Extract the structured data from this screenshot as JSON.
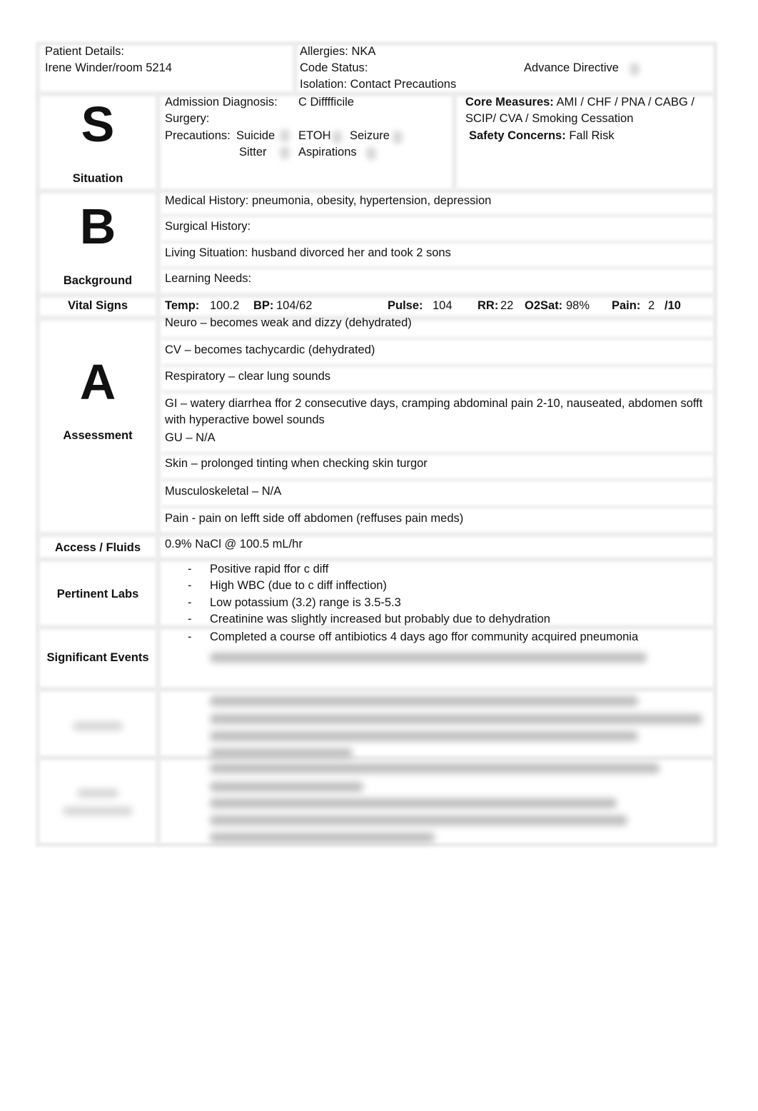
{
  "header": {
    "patient_details_label": "Patient Details:",
    "patient_name_room": "Irene Winder/room 5214",
    "allergies": "Allergies: NKA",
    "code_status": "Code Status:",
    "isolation": "Isolation: Contact Precautions",
    "advance_directive": "Advance Directive"
  },
  "situation": {
    "letter": "S",
    "label": "Situation",
    "admission_diagnosis_label": "Admission Diagnosis:",
    "admission_diagnosis_value": "C Difffficile",
    "surgery_label": "Surgery:",
    "precautions_label": "Precautions:",
    "precaution_options": [
      "Suicide",
      "ETOH",
      "Seizure",
      "Sitter",
      "Aspirations"
    ],
    "core_measures_label": "Core Measures:",
    "core_measures_value_line1": "AMI / CHF / PNA / CABG /",
    "core_measures_value_line2": "SCIP/ CVA / Smoking Cessation",
    "safety_concerns_label": "Safety Concerns:",
    "safety_concerns_value": "Fall Risk"
  },
  "background": {
    "letter": "B",
    "label": "Background",
    "medical_history": "Medical History: pneumonia, obesity, hypertension, depression",
    "surgical_history": "Surgical History:",
    "living_situation": "Living Situation: husband divorced her and took 2 sons",
    "learning_needs": "Learning Needs:"
  },
  "vital_signs": {
    "label": "Vital Signs",
    "temp_label": "Temp:",
    "temp": "100.2",
    "bp_label": "BP:",
    "bp": "104/62",
    "pulse_label": "Pulse:",
    "pulse": "104",
    "rr_label": "RR:",
    "rr": "22",
    "o2sat_label": "O2Sat:",
    "o2sat": "98%",
    "pain_label": "Pain:",
    "pain": "2",
    "pain_scale": "/10"
  },
  "assessment": {
    "letter": "A",
    "label": "Assessment",
    "items": [
      "Neuro – becomes weak and dizzy (dehydrated)",
      "CV – becomes tachycardic (dehydrated)",
      "Respiratory – clear lung sounds",
      "GI – watery diarrhea ffor 2 consecutive days, cramping abdominal pain 2-10, nauseated, abdomen sofft with hyperactive bowel sounds",
      "GU – N/A",
      "Skin – prolonged tinting when checking skin turgor",
      "Musculoskeletal – N/A",
      "Pain - pain on lefft side off abdomen (reffuses pain meds)"
    ]
  },
  "access_fluids": {
    "label": "Access / Fluids",
    "value": "0.9% NaCl @ 100.5 mL/hr"
  },
  "pertinent_labs": {
    "label": "Pertinent Labs",
    "bullet": "-",
    "items": [
      "Positive rapid ffor c diff",
      "High WBC (due to c diff inffection)",
      "Low potassium (3.2) range is 3.5-5.3",
      "Creatinine was slightly increased but probably due to dehydration"
    ]
  },
  "significant_events": {
    "label": "Significant Events",
    "bullet": "-",
    "items": [
      "Completed a course off antibiotics 4 days ago ffor community acquired pneumonia"
    ]
  }
}
